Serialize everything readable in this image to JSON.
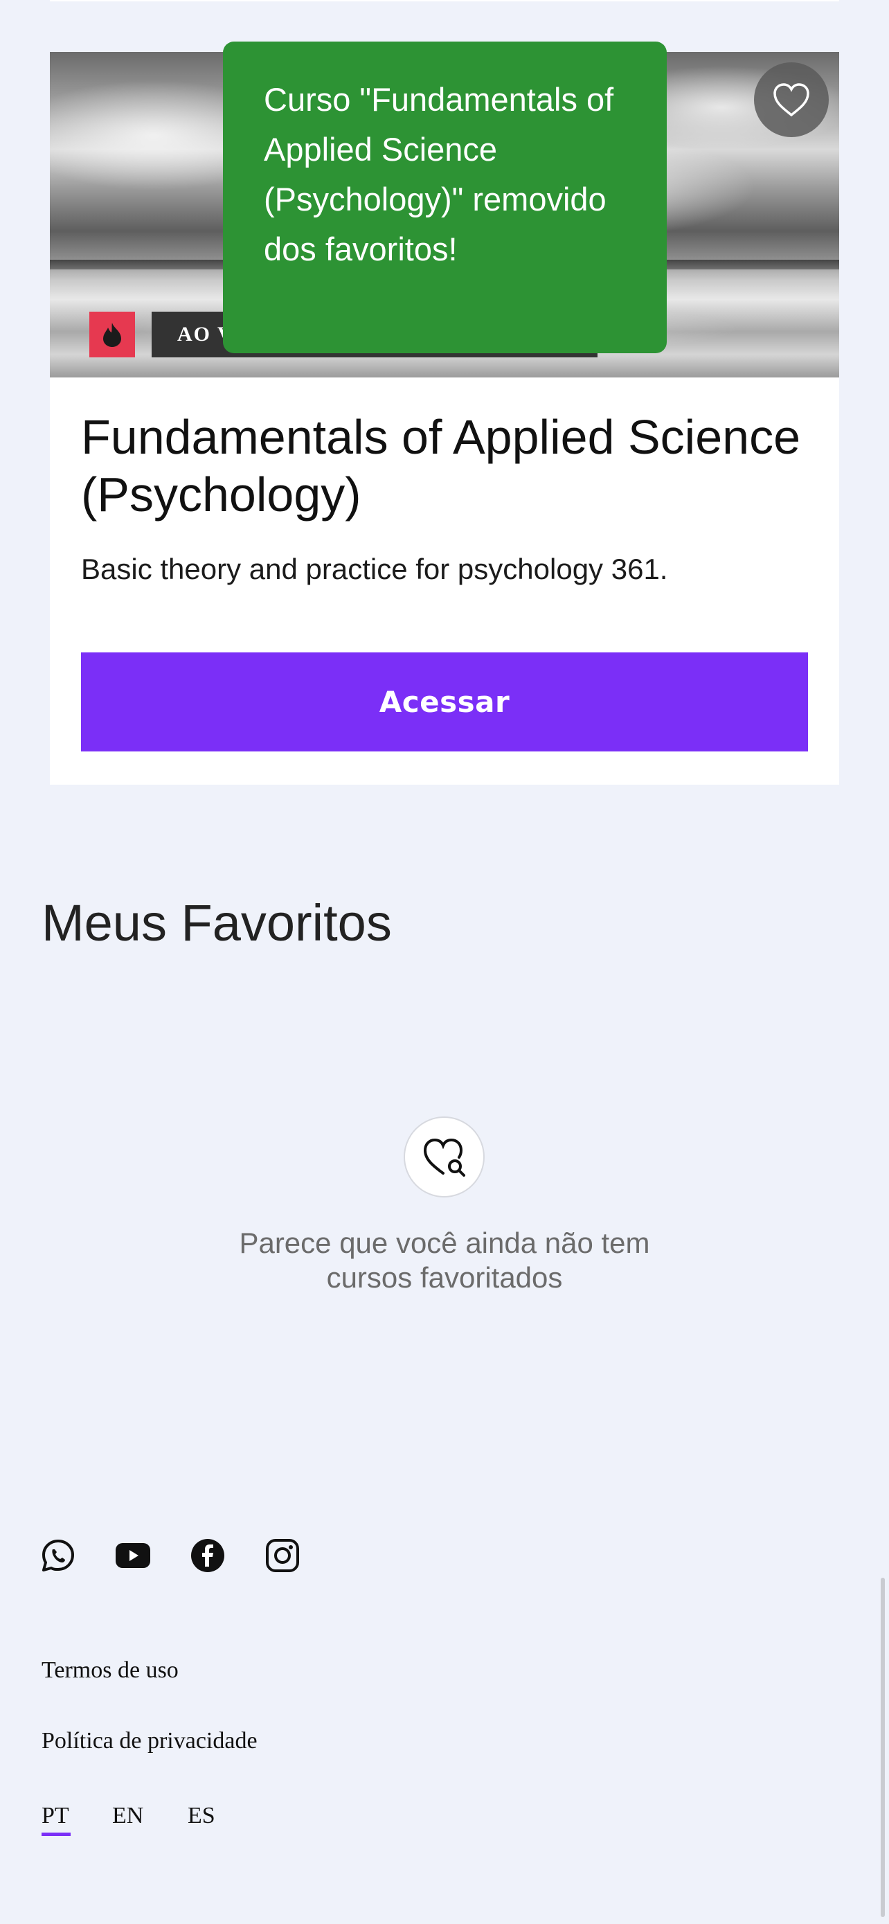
{
  "course_card": {
    "title": "Fundamentals of Applied Science (Psychology)",
    "description": "Basic theory and practice for psychology 361.",
    "live_badge": "AO VIVO",
    "access_button": "Acessar"
  },
  "toast": {
    "message": "Curso \"Fundamentals of Applied Science (Psychology)\" removido dos favoritos!",
    "color": "#2d9334"
  },
  "favorites": {
    "title": "Meus Favoritos",
    "empty_message": "Parece que você ainda não tem cursos favoritados"
  },
  "social_icons": [
    "whatsapp-icon",
    "youtube-icon",
    "facebook-icon",
    "instagram-icon"
  ],
  "footer": {
    "terms": "Termos de uso",
    "privacy": "Política de privacidade",
    "languages": [
      "PT",
      "EN",
      "ES"
    ],
    "active_language": "PT"
  },
  "colors": {
    "accent": "#7b2ff7",
    "live": "#e63950",
    "background": "#eff2fa"
  }
}
